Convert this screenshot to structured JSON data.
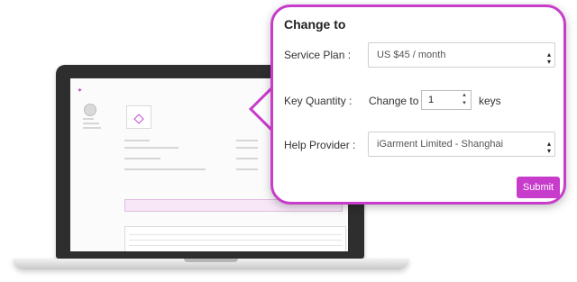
{
  "callout": {
    "title": "Change to",
    "service_plan": {
      "label": "Service Plan :",
      "value": "US $45 / month"
    },
    "key_quantity": {
      "label": "Key Quantity :",
      "prefix": "Change to",
      "value": "1",
      "suffix": "keys"
    },
    "help_provider": {
      "label": "Help Provider :",
      "value": "iGarment Limited - Shanghai"
    },
    "submit_label": "Submit"
  },
  "colors": {
    "accent": "#c83ccc"
  }
}
